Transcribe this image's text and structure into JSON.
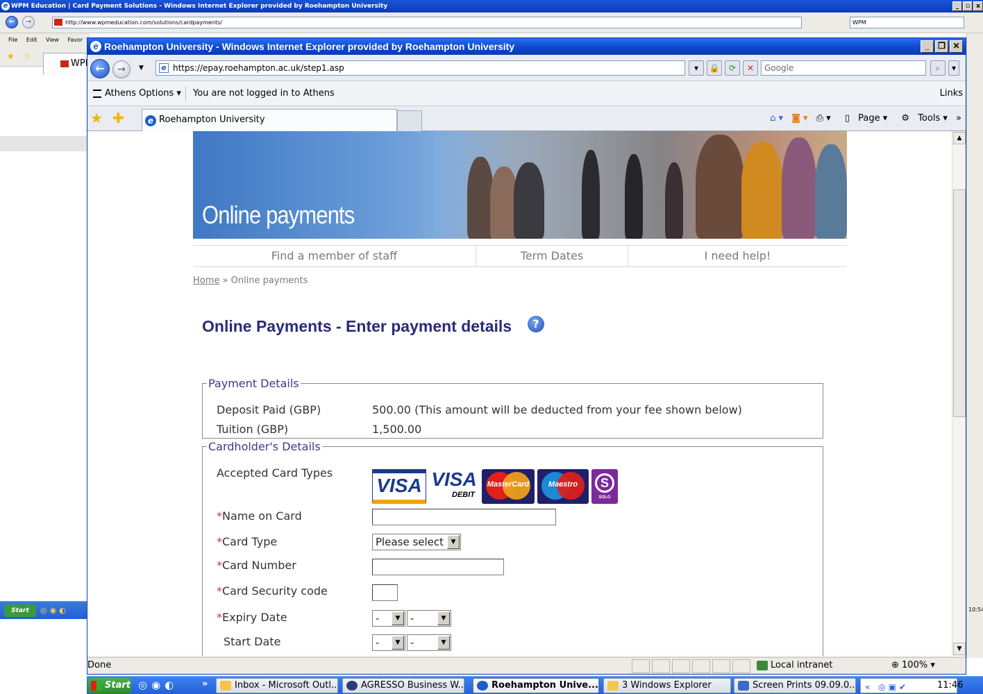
{
  "background_window": {
    "title": "WPM Education | Card Payment Solutions - Windows Internet Explorer provided by Roehampton University",
    "url": "http://www.wpmeducation.com/solutions/cardpayments/",
    "search_value": "WPM",
    "menu": "File Edit View Favor",
    "tab_label": "WPM Educa",
    "taskbar_start": "Start",
    "clock": "10:54"
  },
  "window": {
    "title": "Roehampton University - Windows Internet Explorer provided by Roehampton University",
    "url": "https://epay.roehampton.ac.uk/step1.asp",
    "search_placeholder": "Google",
    "athens_options": "Athens Options ▾",
    "athens_status": "You are not logged in to Athens",
    "links": "Links",
    "tab_title": "Roehampton University",
    "toolbar": {
      "page": "Page ▾",
      "tools": "Tools ▾",
      "more": "»"
    }
  },
  "page": {
    "banner_title": "Online payments",
    "nav": [
      "Find a member of staff",
      "Term Dates",
      "I need help!"
    ],
    "breadcrumb": {
      "home": "Home",
      "sep": " » ",
      "current": "Online payments"
    },
    "heading": "Online Payments - Enter payment details",
    "payment_details": {
      "legend": "Payment Details",
      "rows": [
        {
          "label": "Deposit Paid (GBP)",
          "value": "500.00  (This amount will be deducted from your fee shown below)"
        },
        {
          "label": "Tuition (GBP)",
          "value": "1,500.00"
        }
      ]
    },
    "cardholder": {
      "legend": "Cardholder's Details",
      "accepted_label": "Accepted Card Types",
      "cards": {
        "visa": "VISA",
        "visa_debit": "VISA",
        "debit": "DEBIT",
        "mastercard": "MasterCard",
        "maestro": "Maestro",
        "solo": "SOLO"
      },
      "required_mark": "*",
      "name_label": "Name on Card",
      "card_type_label": "Card Type",
      "card_type_value": "Please select",
      "card_number_label": "Card Number",
      "security_label": "Card Security code",
      "expiry_label": "Expiry Date",
      "expiry_month": "-",
      "expiry_year": "-",
      "start_label": "Start Date",
      "start_month": "-",
      "start_year": "-"
    }
  },
  "statusbar": {
    "text": "Done",
    "zone": "Local intranet",
    "zoom": "100%"
  },
  "taskbar": {
    "start": "Start",
    "ql_more": "»",
    "items": [
      "Inbox - Microsoft Outl...",
      "AGRESSO Business W...",
      "Roehampton Unive...",
      "3 Windows Explorer",
      "Screen Prints 09.09.0..."
    ],
    "tray_chevron": "«",
    "clock": "11:46"
  },
  "colors": {
    "heading": "#2a2a7a",
    "legend": "#3a3a8a",
    "required": "#c0392b",
    "title_bar": "#0b46c8"
  }
}
